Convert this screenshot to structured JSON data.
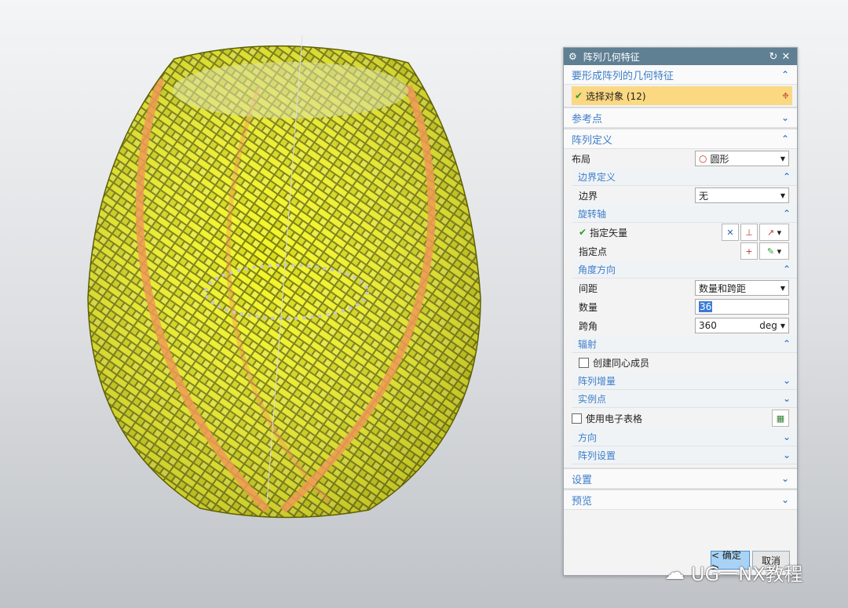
{
  "dialog": {
    "title": "阵列几何特征",
    "groups": {
      "features": {
        "label": "要形成阵列的几何特征",
        "select_label": "选择对象 (12)"
      },
      "reference": {
        "label": "参考点"
      },
      "definition": {
        "label": "阵列定义",
        "layout_label": "布局",
        "layout_value": "圆形",
        "boundary": {
          "label": "边界定义",
          "field_label": "边界",
          "field_value": "无"
        },
        "axis": {
          "label": "旋转轴",
          "vector_label": "指定矢量",
          "point_label": "指定点"
        },
        "angle": {
          "label": "角度方向",
          "spacing_label": "间距",
          "spacing_value": "数量和跨距",
          "count_label": "数量",
          "count_value": "36",
          "span_label": "跨角",
          "span_value": "360",
          "span_unit": "deg"
        },
        "radial": {
          "label": "辐射",
          "checkbox_label": "创建同心成员"
        },
        "increment": {
          "label": "阵列增量"
        },
        "instance": {
          "label": "实例点"
        },
        "spreadsheet_label": "使用电子表格",
        "direction": {
          "label": "方向"
        },
        "settings": {
          "label": "阵列设置"
        }
      },
      "settings": {
        "label": "设置"
      },
      "preview": {
        "label": "预览"
      }
    },
    "ok_label": "< 确定 >",
    "cancel_label": "取消"
  },
  "watermark": {
    "text": "UG一NX教程"
  },
  "colors": {
    "titlebar": "#5f7f93",
    "accent": "#3d7ec9",
    "selection": "#fbd882",
    "model": "#e6ea1a",
    "strip": "#f1a060"
  }
}
